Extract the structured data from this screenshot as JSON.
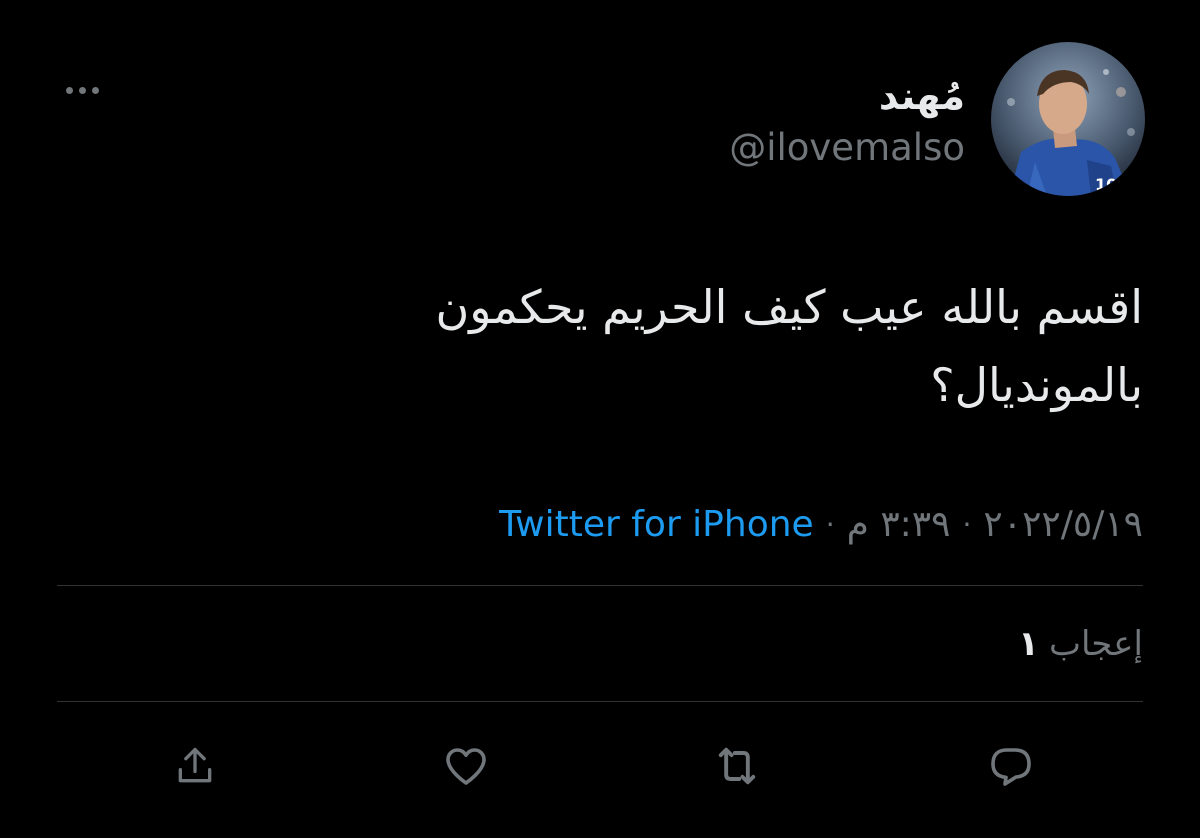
{
  "author": {
    "display_name": "مُهند",
    "handle": "@ilovemalso",
    "avatar_icon": "profile-photo-icon"
  },
  "tweet": {
    "text": "اقسم بالله عيب كيف الحريم يحكمون بالمونديال؟",
    "date": "٢٠٢٢/٥/١٩",
    "time": "٣:٣٩ م",
    "separator": "·",
    "source": "Twitter for iPhone"
  },
  "stats": {
    "likes_count": "١",
    "likes_label": "إعجاب"
  },
  "actions": {
    "reply_icon": "reply-icon",
    "retweet_icon": "retweet-icon",
    "like_icon": "heart-icon",
    "share_icon": "share-icon",
    "more_icon": "more-options-icon"
  },
  "colors": {
    "background": "#000000",
    "text_primary": "#e7e9ea",
    "text_secondary": "#71767b",
    "link": "#1d9bf0",
    "divider": "#2f3336"
  }
}
